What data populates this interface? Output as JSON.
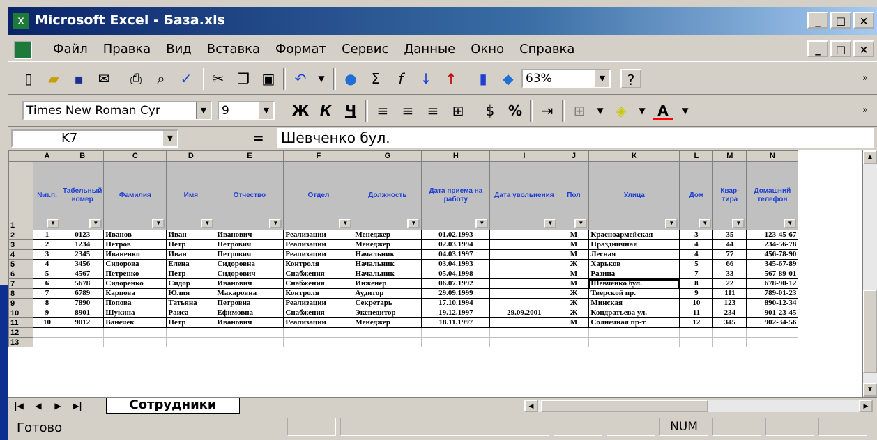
{
  "window": {
    "title": "Microsoft Excel - База.xls",
    "min": "_",
    "max": "□",
    "close": "×"
  },
  "menu": [
    "Файл",
    "Правка",
    "Вид",
    "Вставка",
    "Формат",
    "Сервис",
    "Данные",
    "Окно",
    "Справка"
  ],
  "toolbar": {
    "zoom": "63%",
    "help": "?",
    "font": "Times New Roman Cyr",
    "size": "9",
    "bold": "Ж",
    "italic": "К",
    "underline": "Ч",
    "percent": "%",
    "sigma": "Σ",
    "fx": "f",
    "fontcolor": "A"
  },
  "formula": {
    "cell": "K7",
    "eq": "=",
    "value": "Шевченко бул."
  },
  "columns": [
    "A",
    "B",
    "C",
    "D",
    "E",
    "F",
    "G",
    "H",
    "I",
    "J",
    "K",
    "L",
    "M",
    "N"
  ],
  "headers": [
    "№п.п.",
    "Табельный номер",
    "Фамилия",
    "Имя",
    "Отчество",
    "Отдел",
    "Должность",
    "Дата приема на работу",
    "Дата увольнения",
    "Пол",
    "Улица",
    "Дом",
    "Квар-тира",
    "Домашний телефон"
  ],
  "rows": [
    [
      "1",
      "0123",
      "Иванов",
      "Иван",
      "Иванович",
      "Реализации",
      "Менеджер",
      "01.02.1993",
      "",
      "М",
      "Красноармейская",
      "3",
      "35",
      "123-45-67"
    ],
    [
      "2",
      "1234",
      "Петров",
      "Петр",
      "Петрович",
      "Реализации",
      "Менеджер",
      "02.03.1994",
      "",
      "М",
      "Праздничная",
      "4",
      "44",
      "234-56-78"
    ],
    [
      "3",
      "2345",
      "Иваненко",
      "Иван",
      "Петрович",
      "Реализации",
      "Начальник",
      "04.03.1997",
      "",
      "М",
      "Лесная",
      "4",
      "77",
      "456-78-90"
    ],
    [
      "4",
      "3456",
      "Сидорова",
      "Елена",
      "Сидоровна",
      "Контроля",
      "Начальник",
      "03.04.1993",
      "",
      "Ж",
      "Харьков",
      "5",
      "66",
      "345-67-89"
    ],
    [
      "5",
      "4567",
      "Петренко",
      "Петр",
      "Сидорович",
      "Снабжения",
      "Начальник",
      "05.04.1998",
      "",
      "М",
      "Разина",
      "7",
      "33",
      "567-89-01"
    ],
    [
      "6",
      "5678",
      "Сидоренко",
      "Сидор",
      "Иванович",
      "Снабжения",
      "Инженер",
      "06.07.1992",
      "",
      "М",
      "Шевченко бул.",
      "8",
      "22",
      "678-90-12"
    ],
    [
      "7",
      "6789",
      "Карпова",
      "Юлия",
      "Макаровна",
      "Контроля",
      "Аудитор",
      "29.09.1999",
      "",
      "Ж",
      "Тверской пр.",
      "9",
      "111",
      "789-01-23"
    ],
    [
      "8",
      "7890",
      "Попова",
      "Татьяна",
      "Петровна",
      "Реализации",
      "Секретарь",
      "17.10.1994",
      "",
      "Ж",
      "Минская",
      "10",
      "123",
      "890-12-34"
    ],
    [
      "9",
      "8901",
      "Шукина",
      "Раиса",
      "Ефимовна",
      "Снабжения",
      "Экспедитор",
      "19.12.1997",
      "29.09.2001",
      "Ж",
      "Кондратьева ул.",
      "11",
      "234",
      "901-23-45"
    ],
    [
      "10",
      "9012",
      "Ванечек",
      "Петр",
      "Иванович",
      "Реализации",
      "Менеджер",
      "18.11.1997",
      "",
      "М",
      "Солнечная пр-т",
      "12",
      "345",
      "902-34-56"
    ]
  ],
  "sheet_tab": "Сотрудники",
  "status": {
    "ready": "Готово",
    "num": "NUM"
  }
}
